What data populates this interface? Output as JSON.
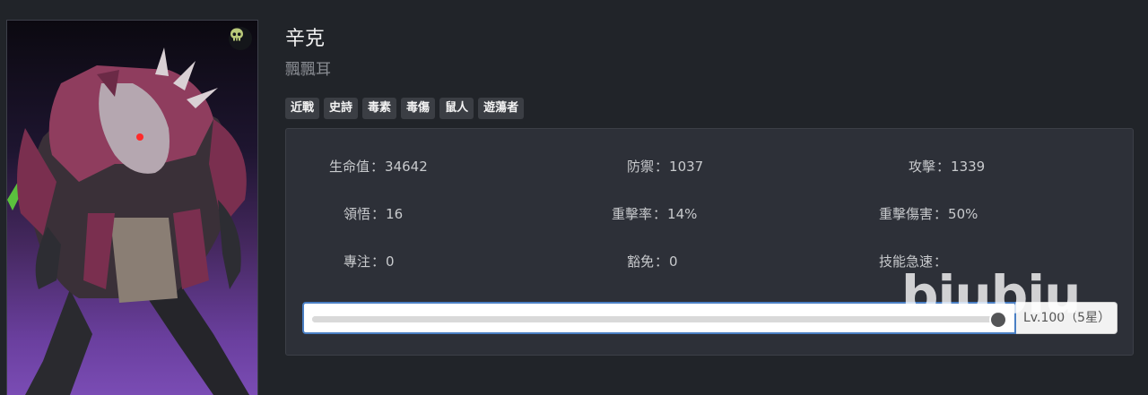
{
  "character": {
    "name": "辛克",
    "subtitle": "飄飄耳",
    "portrait_icon": "skull-icon",
    "tags": [
      "近戰",
      "史詩",
      "毒素",
      "毒傷",
      "鼠人",
      "遊蕩者"
    ]
  },
  "stats": [
    {
      "label": "生命值",
      "value": "34642"
    },
    {
      "label": "防禦",
      "value": "1037"
    },
    {
      "label": "攻擊",
      "value": "1339"
    },
    {
      "label": "領悟",
      "value": "16"
    },
    {
      "label": "重擊率",
      "value": "14%"
    },
    {
      "label": "重擊傷害",
      "value": "50%"
    },
    {
      "label": "專注",
      "value": "0"
    },
    {
      "label": "豁免",
      "value": "0"
    },
    {
      "label": "技能急速",
      "value": ""
    }
  ],
  "level_slider": {
    "value_fraction": 1.0,
    "label": "Lv.100（5星）"
  },
  "watermark": "biubiu",
  "colors": {
    "background": "#212429",
    "panel": "#2d3038",
    "tag": "#3b3e44",
    "slider_focus": "#4a7fc4"
  }
}
